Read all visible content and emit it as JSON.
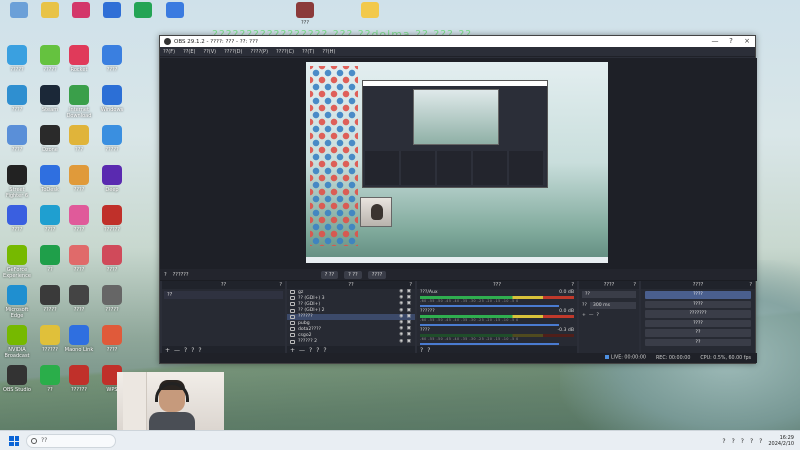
{
  "desktop": {
    "overlay_text": "????????????????? ??? ??dolma ?? ??? ??",
    "top_icons": [
      {
        "label": "",
        "color": "#6ba0d8"
      },
      {
        "label": "",
        "color": "#e8c347"
      },
      {
        "label": "",
        "color": "#d3376a"
      },
      {
        "label": "",
        "color": "#2f6fd6"
      },
      {
        "label": "",
        "color": "#23a455"
      },
      {
        "label": "",
        "color": "#3a7be0"
      },
      {
        "label": "???",
        "color": "#8b3a3a"
      },
      {
        "label": "",
        "color": "#f2c94c"
      }
    ],
    "icons": [
      {
        "label": "?????",
        "color": "#3aa0e0"
      },
      {
        "label": "?????",
        "color": "#65c23f"
      },
      {
        "label": "Rocket",
        "color": "#e03a5a"
      },
      {
        "label": "????",
        "color": "#3a7fe0"
      },
      {
        "label": "????",
        "color": "#2f8fd0"
      },
      {
        "label": "Steam",
        "color": "#1b2838"
      },
      {
        "label": "Internet Download",
        "color": "#3a9f4a"
      },
      {
        "label": "Windows",
        "color": "#2c6fd6"
      },
      {
        "label": "????",
        "color": "#5a8fd8"
      },
      {
        "label": "Dzone",
        "color": "#2a2a2a"
      },
      {
        "label": "???",
        "color": "#e0b43a"
      },
      {
        "label": "?????",
        "color": "#3a8fe0"
      },
      {
        "label": "Street Fighter 6",
        "color": "#222"
      },
      {
        "label": "ToDesk",
        "color": "#2f6fe0"
      },
      {
        "label": "????",
        "color": "#e09a3a"
      },
      {
        "label": "Deep",
        "color": "#5a2ab0"
      },
      {
        "label": "????",
        "color": "#3a5fe0"
      },
      {
        "label": "????",
        "color": "#1f9fd0"
      },
      {
        "label": "????",
        "color": "#e05a9a"
      },
      {
        "label": "??????",
        "color": "#c0302a"
      },
      {
        "label": "GeForce Experience",
        "color": "#76b900"
      },
      {
        "label": "??",
        "color": "#1f9f4a"
      },
      {
        "label": "????",
        "color": "#e06a6a"
      },
      {
        "label": "????",
        "color": "#d04a5a"
      },
      {
        "label": "Microsoft Edge",
        "color": "#1f8fd0"
      },
      {
        "label": "?????",
        "color": "#3a3a3a"
      },
      {
        "label": "????",
        "color": "#444"
      },
      {
        "label": "?????",
        "color": "#666"
      },
      {
        "label": "NVIDIA Broadcast",
        "color": "#76b900"
      },
      {
        "label": "??????",
        "color": "#e0c03a"
      },
      {
        "label": "Maono Link",
        "color": "#2f6fe0"
      },
      {
        "label": "????",
        "color": "#e05a3a"
      },
      {
        "label": "OBS Studio",
        "color": "#333"
      },
      {
        "label": "??",
        "color": "#2aae4a"
      },
      {
        "label": "??????",
        "color": "#c0302a"
      },
      {
        "label": "WPS",
        "color": "#c0302a"
      }
    ]
  },
  "obs": {
    "title": "OBS 29.1.2 - ????: ??? - ??: ???",
    "window_controls": [
      "—",
      "?",
      "×"
    ],
    "menu": [
      "??(F)",
      "??(E)",
      "??(V)",
      "????(D)",
      "????(P)",
      "????(C)",
      "??(T)",
      "??(H)"
    ],
    "source_bar": {
      "source_name": "??????",
      "settings_label": "??",
      "filters_label": "??",
      "deactivate_label": "????"
    },
    "docks": {
      "scenes": {
        "title": "??",
        "items": [
          "??"
        ]
      },
      "sources": {
        "title": "??",
        "items": [
          {
            "name": "gz",
            "selected": false
          },
          {
            "name": "?? (GDI+) 3",
            "selected": false
          },
          {
            "name": "?? (GDI+)",
            "selected": false
          },
          {
            "name": "?? (GDI+) 2",
            "selected": false
          },
          {
            "name": "??????",
            "selected": true
          },
          {
            "name": "pubg",
            "selected": false
          },
          {
            "name": "dota2????",
            "selected": false
          },
          {
            "name": "csgo2",
            "selected": false
          },
          {
            "name": "?????? 2",
            "selected": false
          }
        ]
      },
      "mixer": {
        "title": "???",
        "tracks": [
          {
            "name": "???/Aux",
            "db": "0.0 dB",
            "active": true
          },
          {
            "name": "??????",
            "db": "0.0 dB",
            "active": true
          },
          {
            "name": "????",
            "db": "-0.3 dB",
            "active": false
          }
        ],
        "scale": "-60 -55 -50 -45 -40 -35 -30 -25 -20 -15 -10 -5 0"
      },
      "transitions": {
        "title": "????",
        "type": "??",
        "duration_label": "??",
        "duration": "300 ms"
      },
      "controls": {
        "title": "????",
        "buttons": [
          "????",
          "????",
          "???????",
          "????",
          "??",
          "??"
        ]
      }
    },
    "status": {
      "live": "LIVE: 00:00:00",
      "rec": "REC: 00:00:00",
      "cpu": "CPU: 0.5%, 60.00 fps"
    }
  },
  "taskbar": {
    "search_placeholder": "??",
    "ime": "?",
    "time": "16:29",
    "date": "2024/2/10"
  }
}
